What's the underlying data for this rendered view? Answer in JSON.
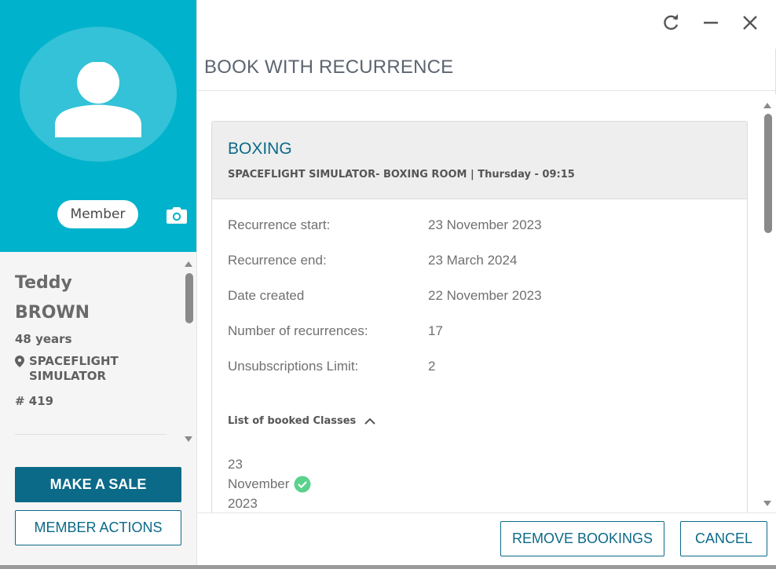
{
  "colors": {
    "accent": "#00b2cc",
    "primary": "#0b6a88",
    "success": "#5bd28c"
  },
  "member": {
    "badge": "Member",
    "first_name": "Teddy",
    "last_name": "BROWN",
    "age": "48 years",
    "location": "SPACEFLIGHT SIMULATOR",
    "id": "# 419"
  },
  "left_actions": {
    "make_sale": "MAKE A SALE",
    "member_actions": "MEMBER ACTIONS"
  },
  "dialog": {
    "title": "BOOK WITH RECURRENCE"
  },
  "class_info": {
    "name": "BOXING",
    "subtitle": "SPACEFLIGHT SIMULATOR- BOXING ROOM | Thursday - 09:15"
  },
  "details": [
    {
      "label": "Recurrence start:",
      "value": "23 November 2023"
    },
    {
      "label": "Recurrence end:",
      "value": "23 March 2024"
    },
    {
      "label": "Date created",
      "value": "22 November 2023"
    },
    {
      "label": "Number of recurrences:",
      "value": "17"
    },
    {
      "label": "Unsubscriptions Limit:",
      "value": "2"
    }
  ],
  "booked_classes": {
    "label": "List of booked Classes",
    "items": [
      {
        "date": "23 November 2023",
        "status_icon": "check-circle-icon"
      }
    ]
  },
  "footer": {
    "remove_bookings": "REMOVE BOOKINGS",
    "cancel": "CANCEL"
  },
  "icons": [
    "refresh-icon",
    "minimize-icon",
    "close-icon",
    "camera-icon",
    "location-pin-icon",
    "chevron-up-icon",
    "check-circle-icon",
    "user-avatar-icon"
  ]
}
